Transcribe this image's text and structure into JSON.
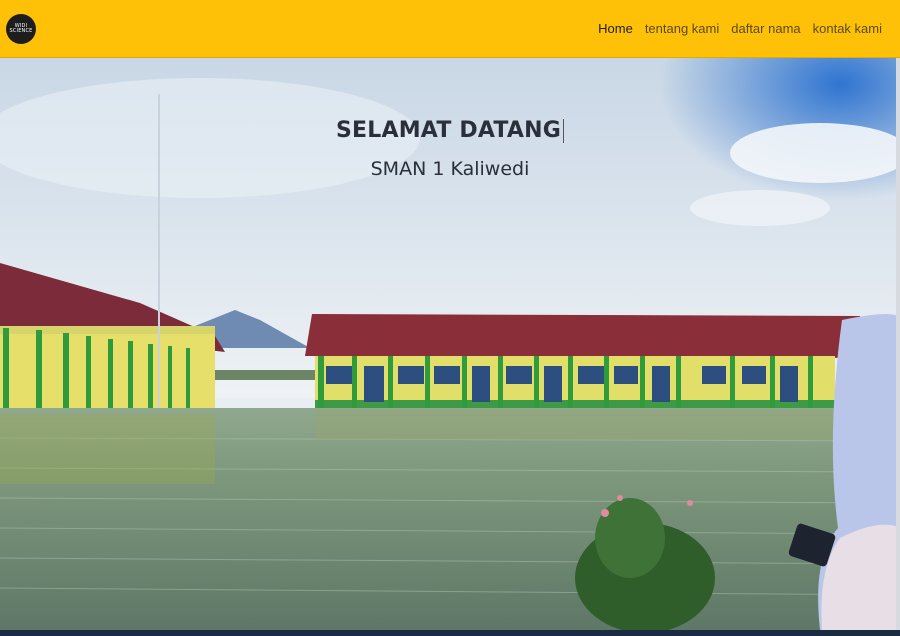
{
  "brand": {
    "logo_line1": "WIDI",
    "logo_line2": "SCIENCE"
  },
  "nav": {
    "items": [
      {
        "label": "Home",
        "active": true
      },
      {
        "label": "tentang kami",
        "active": false
      },
      {
        "label": "daftar nama",
        "active": false
      },
      {
        "label": "kontak kami",
        "active": false
      }
    ]
  },
  "hero": {
    "title": "SELAMAT DATANG",
    "subtitle": "SMAN 1 Kaliwedi"
  },
  "colors": {
    "navbar": "#fec107",
    "footer": "#1b2b44"
  }
}
